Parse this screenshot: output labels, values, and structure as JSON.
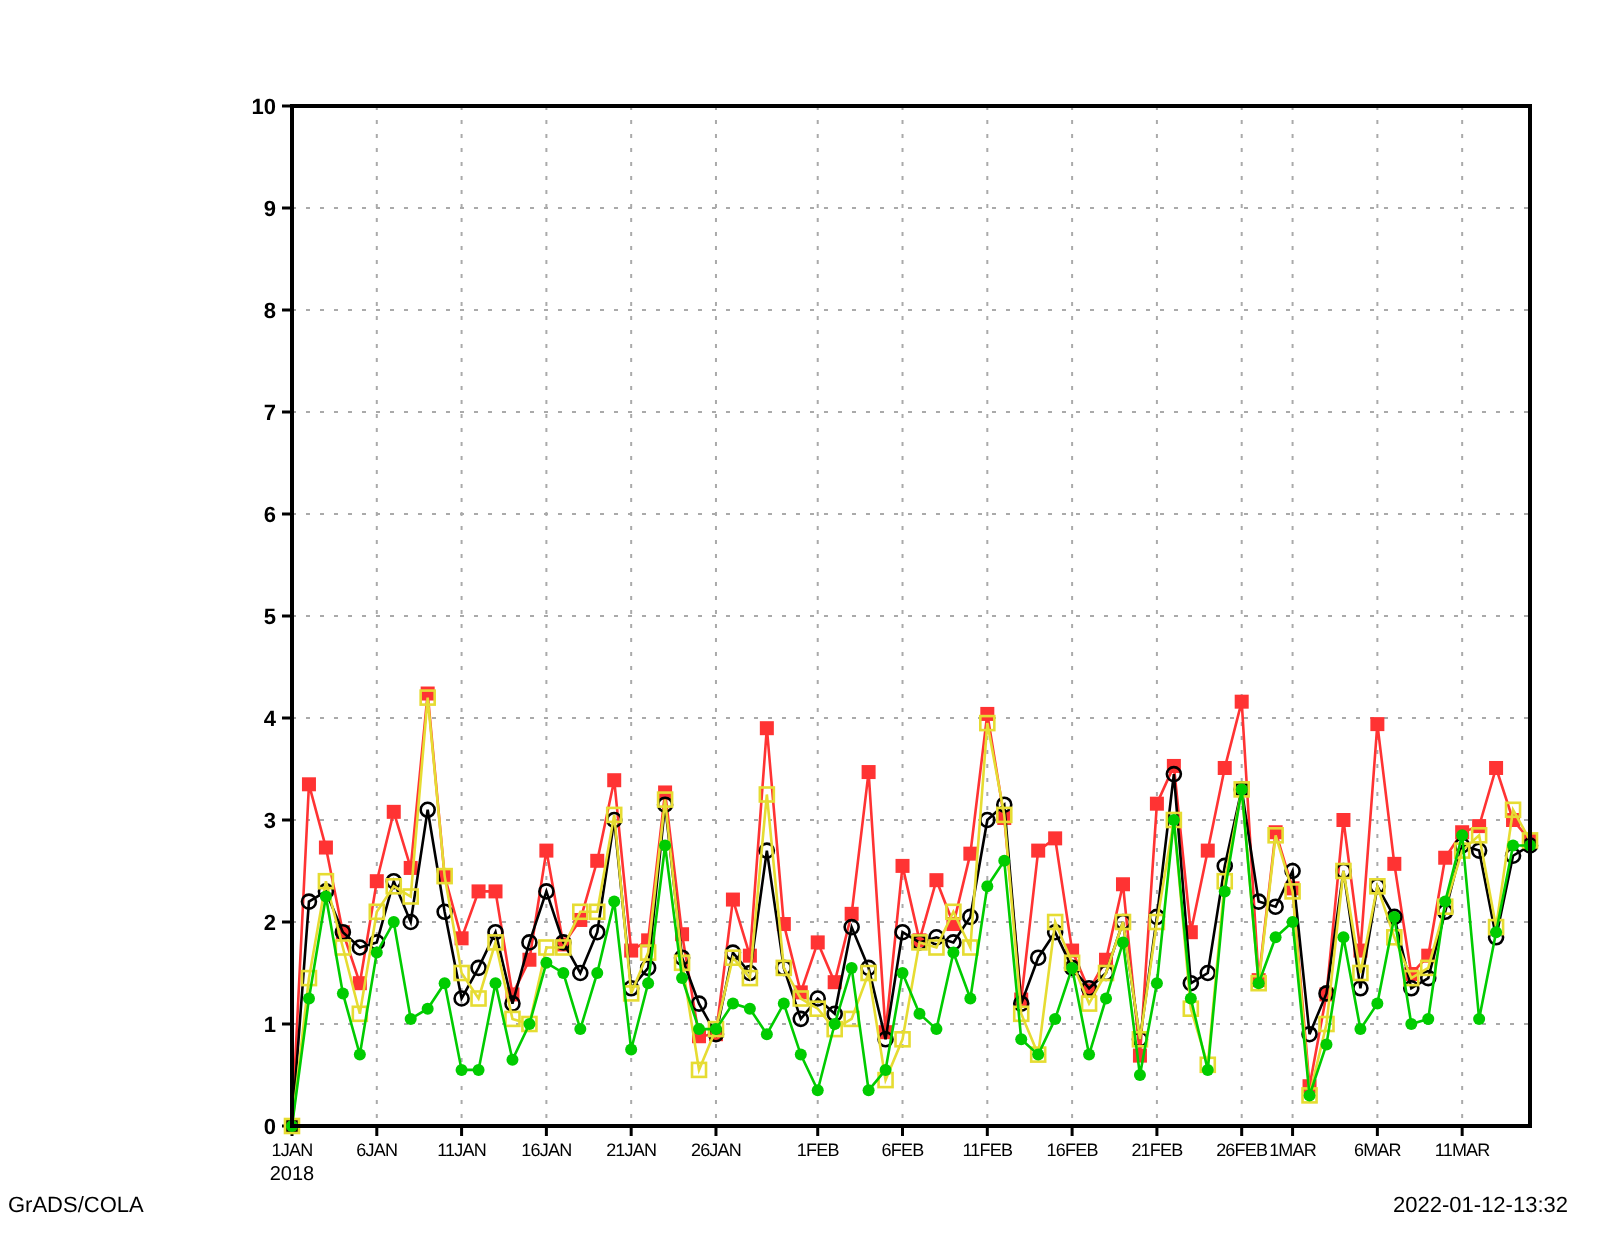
{
  "chart": {
    "year_label": "2018",
    "chart_data": {
      "type": "line",
      "categories": [
        "1JAN",
        null,
        null,
        null,
        null,
        "6JAN",
        null,
        null,
        null,
        null,
        "11JAN",
        null,
        null,
        null,
        null,
        "16JAN",
        null,
        null,
        null,
        null,
        "21JAN",
        null,
        null,
        null,
        null,
        "26JAN",
        null,
        null,
        null,
        null,
        null,
        "1FEB",
        null,
        null,
        null,
        null,
        "6FEB",
        null,
        null,
        null,
        null,
        "11FEB",
        null,
        null,
        null,
        null,
        "16FEB",
        null,
        null,
        null,
        null,
        "21FEB",
        null,
        null,
        null,
        null,
        "26FEB",
        null,
        null,
        "1MAR",
        null,
        null,
        null,
        null,
        "6MAR",
        null,
        null,
        null,
        null,
        "11MAR",
        null,
        null,
        null,
        null
      ],
      "ylim": [
        0,
        10
      ],
      "yticks": [
        0,
        1,
        2,
        3,
        4,
        5,
        6,
        7,
        8,
        9,
        10
      ],
      "grid": true,
      "series": [
        {
          "color": "#ff3333",
          "marker": "square",
          "values": [
            0,
            3.35,
            2.73,
            1.9,
            1.4,
            2.4,
            3.08,
            2.53,
            4.24,
            2.45,
            1.84,
            2.3,
            2.3,
            1.29,
            1.63,
            2.7,
            1.78,
            2.02,
            2.6,
            3.39,
            1.72,
            1.82,
            3.27,
            1.88,
            0.88,
            0.9,
            2.22,
            1.67,
            3.9,
            1.98,
            1.31,
            1.8,
            1.41,
            2.08,
            3.47,
            0.92,
            2.55,
            1.82,
            2.41,
            1.98,
            2.67,
            4.04,
            3.02,
            1.24,
            2.7,
            2.82,
            1.72,
            1.33,
            1.63,
            2.37,
            0.69,
            3.16,
            3.53,
            1.9,
            2.7,
            3.51,
            4.16,
            1.43,
            2.88,
            2.33,
            0.39,
            1.29,
            3.0,
            1.72,
            3.94,
            2.57,
            1.49,
            1.67,
            2.63,
            2.88,
            2.94,
            3.51,
            3.0,
            2.8
          ]
        },
        {
          "color": "#000000",
          "marker": "circle",
          "values": [
            0,
            2.2,
            2.3,
            1.9,
            1.75,
            1.8,
            2.4,
            2.0,
            3.1,
            2.1,
            1.25,
            1.55,
            1.9,
            1.2,
            1.8,
            2.3,
            1.8,
            1.5,
            1.9,
            3.0,
            1.35,
            1.55,
            3.15,
            1.65,
            1.2,
            0.9,
            1.7,
            1.5,
            2.7,
            1.55,
            1.05,
            1.25,
            1.1,
            1.95,
            1.55,
            0.85,
            1.9,
            1.8,
            1.85,
            1.8,
            2.05,
            3.0,
            3.15,
            1.2,
            1.65,
            1.9,
            1.55,
            1.35,
            1.5,
            2.0,
            0.85,
            2.05,
            3.45,
            1.4,
            1.5,
            2.55,
            3.3,
            2.2,
            2.15,
            2.5,
            0.9,
            1.3,
            2.5,
            1.35,
            2.35,
            2.05,
            1.35,
            1.45,
            2.1,
            2.75,
            2.7,
            1.85,
            2.65,
            2.75
          ]
        },
        {
          "color": "#e6dc32",
          "marker": "square",
          "values": [
            0,
            1.45,
            2.4,
            1.75,
            1.1,
            2.1,
            2.35,
            2.25,
            4.2,
            2.45,
            1.5,
            1.25,
            1.8,
            1.05,
            1.0,
            1.75,
            1.75,
            2.1,
            2.1,
            3.05,
            1.3,
            1.7,
            3.2,
            1.6,
            0.55,
            0.95,
            1.65,
            1.45,
            3.25,
            1.55,
            1.25,
            1.15,
            0.95,
            1.05,
            1.5,
            0.45,
            0.85,
            1.8,
            1.75,
            2.1,
            1.75,
            3.95,
            3.05,
            1.1,
            0.7,
            2.0,
            1.6,
            1.2,
            1.5,
            2.0,
            0.85,
            2.0,
            3.0,
            1.15,
            0.6,
            2.4,
            3.3,
            1.4,
            2.85,
            2.3,
            0.3,
            1.0,
            2.5,
            1.5,
            2.35,
            1.85,
            1.45,
            1.55,
            2.15,
            2.7,
            2.85,
            1.95,
            3.1,
            2.8
          ]
        },
        {
          "color": "#00cc00",
          "marker": "circle",
          "values": [
            0,
            1.25,
            2.25,
            1.3,
            0.7,
            1.7,
            2.0,
            1.05,
            1.15,
            1.4,
            0.55,
            0.55,
            1.4,
            0.65,
            1.0,
            1.6,
            1.5,
            0.95,
            1.5,
            2.2,
            0.75,
            1.4,
            2.75,
            1.45,
            0.95,
            0.95,
            1.2,
            1.15,
            0.9,
            1.2,
            0.7,
            0.35,
            1.0,
            1.55,
            0.35,
            0.55,
            1.5,
            1.1,
            0.95,
            1.7,
            1.25,
            2.35,
            2.6,
            0.85,
            0.7,
            1.05,
            1.55,
            0.7,
            1.25,
            1.8,
            0.5,
            1.4,
            3.0,
            1.25,
            0.55,
            2.3,
            3.3,
            1.4,
            1.85,
            2.0,
            0.3,
            0.8,
            1.85,
            0.95,
            1.2,
            2.05,
            1.0,
            1.05,
            2.2,
            2.85,
            1.05,
            1.9,
            2.75,
            2.75
          ]
        }
      ]
    }
  },
  "footer": {
    "left": "GrADS/COLA",
    "right": "2022-01-12-13:32"
  }
}
